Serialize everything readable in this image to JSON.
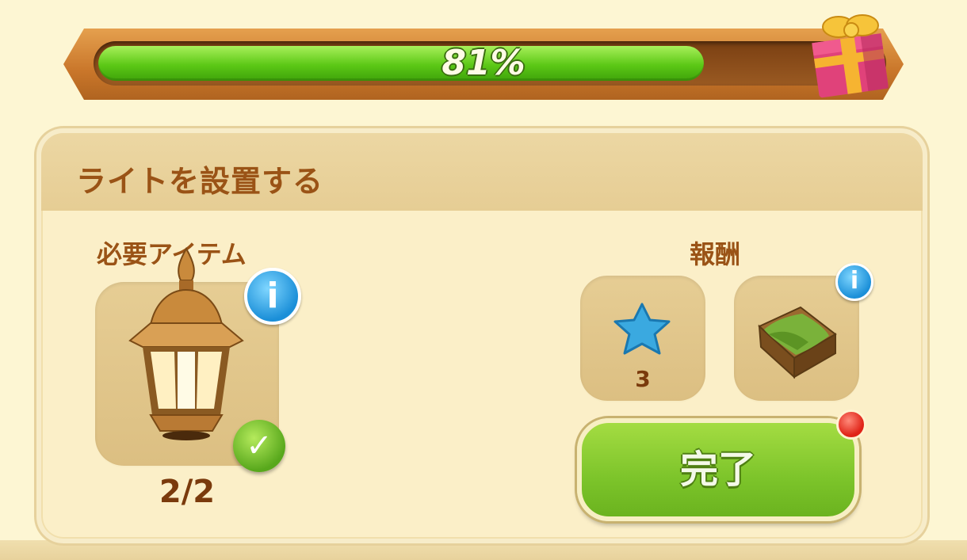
{
  "progress": {
    "percent_label": "81%",
    "value": 0.81,
    "reward_icon": "gift-box-icon"
  },
  "task": {
    "title": "ライトを設置する",
    "required": {
      "label": "必要アイテム",
      "item_icon": "lantern-icon",
      "count": "2/2",
      "status_icon": "checkmark-icon"
    },
    "rewards": {
      "label": "報酬",
      "items": [
        {
          "icon": "blue-star-icon",
          "count": "3"
        },
        {
          "icon": "green-cloth-crate-icon",
          "count": ""
        }
      ]
    },
    "complete_button": "完了"
  },
  "colors": {
    "accent_green": "#7cc42a",
    "text_brown": "#9a5316",
    "panel_bg": "#fbefc8",
    "info_blue": "#1b8fd8",
    "notify_red": "#e02418"
  }
}
